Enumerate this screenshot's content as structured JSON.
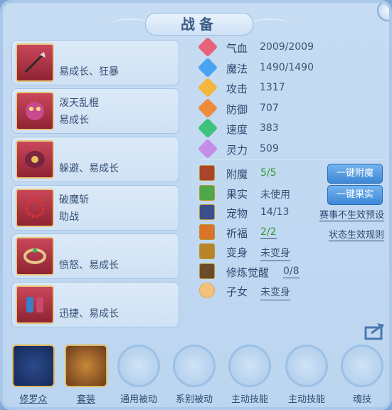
{
  "title": "战备",
  "equipment": [
    {
      "name": "",
      "trait": "易成长、狂暴"
    },
    {
      "name": "泼天乱棍",
      "trait": "易成长"
    },
    {
      "name": "",
      "trait": "躲避、易成长"
    },
    {
      "name": "破魔斩",
      "trait": "助战"
    },
    {
      "name": "",
      "trait": "愤怒、易成长"
    },
    {
      "name": "",
      "trait": "迅捷、易成长"
    }
  ],
  "stats": [
    {
      "label": "气血",
      "value": "2009/2009",
      "icon": "heart-icon",
      "color": "#e8637a"
    },
    {
      "label": "魔法",
      "value": "1490/1490",
      "icon": "mana-icon",
      "color": "#4aa3f0"
    },
    {
      "label": "攻击",
      "value": "1317",
      "icon": "attack-icon",
      "color": "#f2b73c"
    },
    {
      "label": "防御",
      "value": "707",
      "icon": "defense-icon",
      "color": "#f08b3c"
    },
    {
      "label": "速度",
      "value": "383",
      "icon": "speed-icon",
      "color": "#3fc27a"
    },
    {
      "label": "灵力",
      "value": "509",
      "icon": "spirit-icon",
      "color": "#c68de8"
    }
  ],
  "info": [
    {
      "label": "附魔",
      "value": "5/5"
    },
    {
      "label": "果实",
      "value": "未使用"
    },
    {
      "label": "宠物",
      "value": "14/13"
    },
    {
      "label": "祈福",
      "value": "2/2"
    },
    {
      "label": "变身",
      "value": "未变身"
    },
    {
      "label": "修炼觉醒",
      "value": "0/8"
    },
    {
      "label": "子女",
      "value": "未变身"
    }
  ],
  "buttons": {
    "enchant": "一键附魔",
    "fruit": "一键果实"
  },
  "links": {
    "tournament": "赛事不生效预设",
    "status_rule": "状态生效规则"
  },
  "tabs": [
    "修罗众",
    "套装",
    "通用被动",
    "系别被动",
    "主动技能",
    "主动技能",
    "魂技"
  ],
  "colors": {
    "accent_button": "#3e87d6",
    "green_value": "#2f9a2f",
    "title_text": "#3d5c86"
  }
}
